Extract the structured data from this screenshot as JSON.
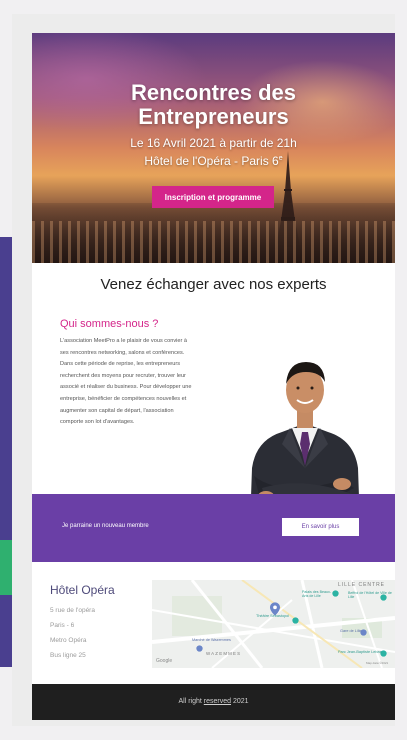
{
  "hero": {
    "title_line1": "Rencontres des",
    "title_line2": "Entrepreneurs",
    "subtitle_line1": "Le 16 Avril 2021 à partir de 21h",
    "subtitle_line2": "Hôtel de l'Opéra - Paris 6",
    "subtitle_sup": "e",
    "button_label": "Inscription et programme"
  },
  "section": {
    "title": "Venez échanger avec nos experts"
  },
  "about": {
    "heading": "Qui sommes-nous ?",
    "body": "L'association MeetPro a le plaisir de vous convier à ses rencontres networking, salons et conférences. Dans cette période de reprise, les entrepreneurs recherchent des moyens pour recruter, trouver leur associé et réaliser du business. Pour développer une entreprise, bénéficier de compétences nouvelles et augmenter son capital de départ, l'association comporte son lot d'avantages."
  },
  "band": {
    "text": "Je parraine un nouveau membre",
    "button_label": "En savoir plus"
  },
  "hotel": {
    "name": "Hôtel Opéra",
    "address_lines": [
      "5 rue de l'opéra",
      "Paris - 6",
      "Metro Opéra",
      "Bus ligne 25"
    ]
  },
  "map": {
    "labels": {
      "lille_centre": "LILLE CENTRE",
      "theatre": "Théâtre Sébastopol",
      "beffroi": "Beffroi de l'Hôtel de Ville de Lille",
      "palais": "Palais des Beaux-Arts de Lille",
      "marche": "Marché de Wazemmes",
      "wazemmes": "WAZEMMES",
      "parc": "Parc Jean-Baptiste Lebas",
      "gare": "Gare de Lille",
      "google": "Google",
      "credit": "Map data ©2021"
    },
    "pin_color": "#6b86c8",
    "poi_color": "#2bb3a3"
  },
  "footer": {
    "prefix": "All right ",
    "link": "reserved",
    "suffix": " 2021"
  },
  "colors": {
    "accent_pink": "#d4258a",
    "band_purple": "#6a3fa6",
    "footer_dark": "#1f1f1f"
  }
}
